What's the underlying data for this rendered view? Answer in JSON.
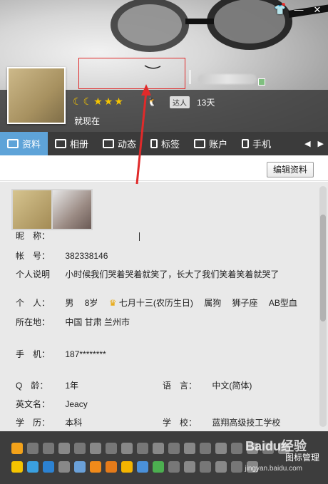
{
  "header": {
    "status_text": "就现在",
    "talent_label": "达人",
    "days_text": "13天"
  },
  "tabs": [
    {
      "label": "资料",
      "active": true
    },
    {
      "label": "相册"
    },
    {
      "label": "动态"
    },
    {
      "label": "标签"
    },
    {
      "label": "账户"
    },
    {
      "label": "手机"
    }
  ],
  "toolbar": {
    "edit_label": "编辑资料"
  },
  "profile": {
    "nickname_label": "昵　称：",
    "nickname_value": "",
    "account_label": "帐　号：",
    "account_value": "382338146",
    "bio_label": "个人说明",
    "bio_value": "小时候我们哭着哭着就笑了，长大了我们笑着笑着就哭了",
    "personal_label": "个　人：",
    "gender": "男",
    "age": "8岁",
    "birthday": "七月十三(农历生日)",
    "zodiac": "属狗",
    "constellation": "狮子座",
    "blood": "AB型血",
    "location_label": "所在地：",
    "location_value": "中国 甘肃 兰州市",
    "phone_label": "手　机：",
    "phone_value": "187********",
    "qage_label": "Q　龄：",
    "qage_value": "1年",
    "lang_label": "语　言：",
    "lang_value": "中文(简体)",
    "english_label": "英文名：",
    "english_value": "Jeacy",
    "edu_label": "学　历：",
    "edu_value": "本科",
    "school_label": "学　校：",
    "school_value": "蓝翔高级技工学校"
  },
  "iconbar": {
    "manage_label": "图标管理"
  },
  "watermark": {
    "main": "Baidu经验",
    "sub": "jingyan.baidu.com"
  },
  "colors": {
    "tab_active": "#5ea3d8",
    "annotation_red": "#e02a2a",
    "star_gold": "#f5c400"
  }
}
